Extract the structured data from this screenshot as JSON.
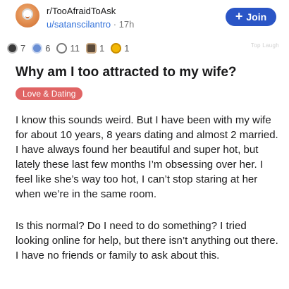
{
  "post": {
    "subreddit": "r/TooAfraidToAsk",
    "user": "u/satanscilantro",
    "separator": "·",
    "age": "17h",
    "join_label": "Join",
    "join_icon": "plus-icon",
    "awards": [
      {
        "icon": "award-icon",
        "count": "7"
      },
      {
        "icon": "award-icon",
        "count": "6"
      },
      {
        "icon": "award-icon",
        "count": "11"
      },
      {
        "icon": "award-icon",
        "count": "1"
      },
      {
        "icon": "gold-award-icon",
        "count": "1"
      }
    ],
    "watermark": "Top Laugh",
    "title": "Why am I too attracted to my wife?",
    "flair": "Love & Dating",
    "paragraphs": [
      "I know this sounds weird. But I have been with my wife for about 10 years, 8 years dating and almost 2 married. I have always found her beautiful and super hot, but lately  these last few months I’m obsessing over her. I feel like she’s way too hot, I can’t stop staring at her when we’re in the same room.",
      "Is this normal? Do I need to do something? I tried looking online for help, but there isn’t anything out there. I have no friends or family to ask about this."
    ]
  },
  "colors": {
    "join_button": "#2a55c6",
    "username_link": "#2f6fd9",
    "flair_background": "#e06464",
    "avatar": "#e08a4c"
  }
}
